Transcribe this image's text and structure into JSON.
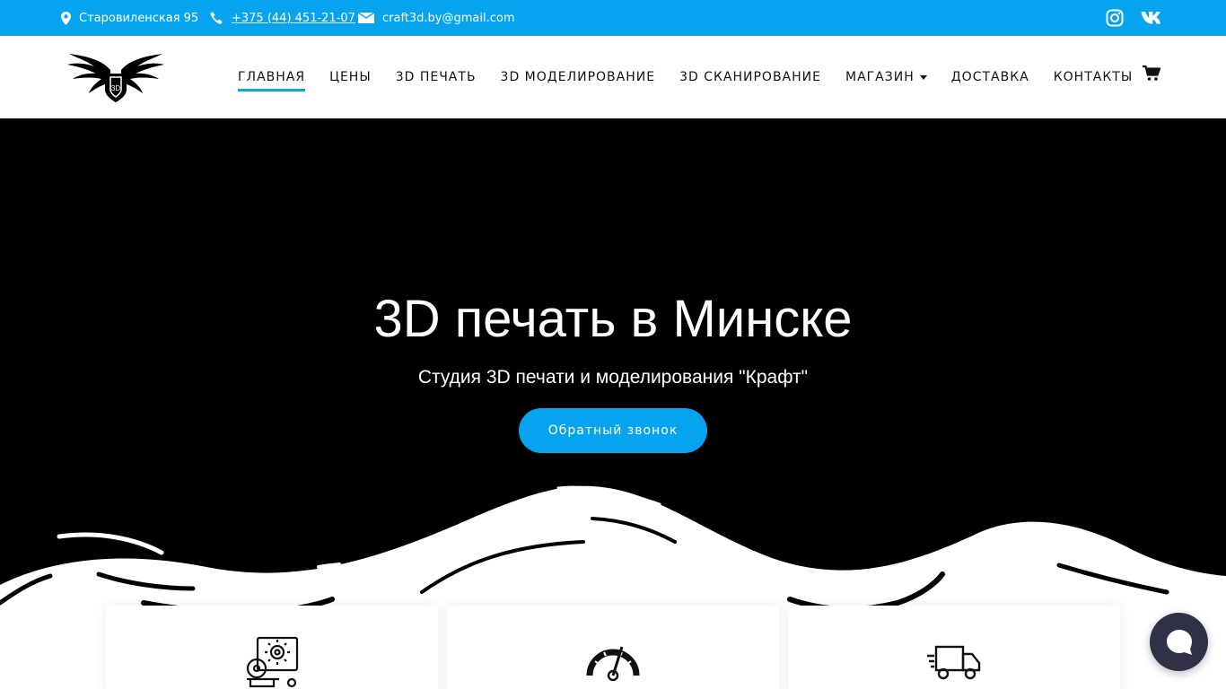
{
  "topbar": {
    "address": "Старовиленская 95",
    "phone": "+375 (44) 451-21-07",
    "email": "craft3d.by@gmail.com",
    "social": [
      "instagram-icon",
      "vk-icon"
    ]
  },
  "nav": {
    "items": [
      {
        "label": "Главная",
        "active": true
      },
      {
        "label": "Цены"
      },
      {
        "label": "3D печать"
      },
      {
        "label": "3D моделирование"
      },
      {
        "label": "3D сканирование"
      },
      {
        "label": "Магазин",
        "has_dropdown": true
      },
      {
        "label": "Доставка"
      },
      {
        "label": "Контакты"
      }
    ],
    "cart_icon": "shopping-cart-icon"
  },
  "hero": {
    "title": "3D печать в Минске",
    "subtitle": "Студия 3D печати и моделирования \"Крафт\"",
    "button": "Обратный звонок"
  },
  "features": {
    "icons": [
      "printer-gear-icon",
      "speedometer-icon",
      "delivery-truck-icon"
    ]
  },
  "colors": {
    "accent": "#06a4ee",
    "hero_bg": "#000000",
    "chat": "#2f3247"
  }
}
